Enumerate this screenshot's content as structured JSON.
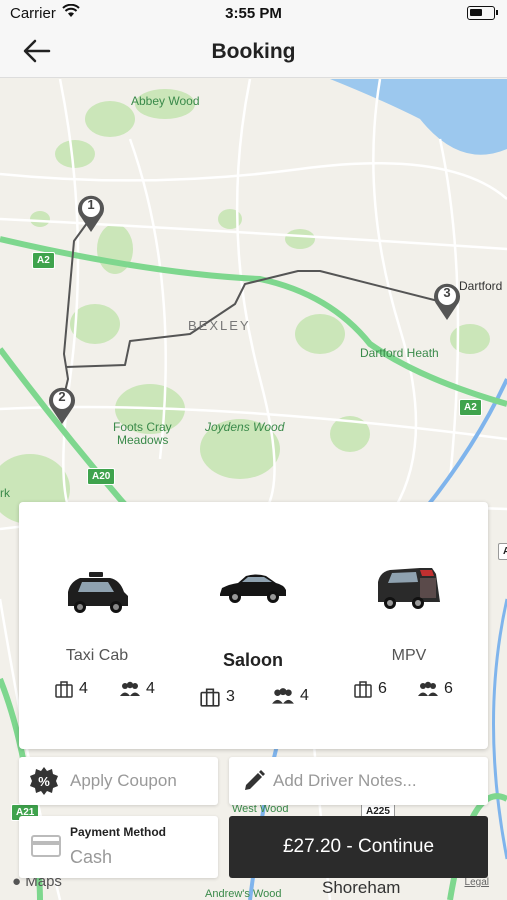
{
  "status_bar": {
    "carrier": "Carrier",
    "time": "3:55 PM"
  },
  "nav": {
    "title": "Booking"
  },
  "map": {
    "labels": {
      "abbey_wood": "Abbey Wood",
      "bexley": "BEXLEY",
      "dartford": "Dartford",
      "dartford_heath": "Dartford Heath",
      "foots_cray_1": "Foots Cray",
      "foots_cray_2": "Meadows",
      "joydens_wood": "Joydens Wood",
      "park": "rk",
      "shoreham": "Shoreham",
      "andrews_wood": "Andrew's Wood",
      "west_wood": "West Wood"
    },
    "roads": {
      "a2_left": "A2",
      "a2_right": "A2",
      "a20": "A20",
      "a21": "A21",
      "a225": "A225",
      "edge_a": "A"
    },
    "stops": [
      "1",
      "2",
      "3"
    ],
    "attribution": "Maps",
    "legal": "Legal"
  },
  "vehicles": [
    {
      "name": "Taxi Cab",
      "luggage": "4",
      "passengers": "4",
      "selected": false,
      "icon": "taxi-cab-icon"
    },
    {
      "name": "Saloon",
      "luggage": "3",
      "passengers": "4",
      "selected": true,
      "icon": "saloon-car-icon"
    },
    {
      "name": "MPV",
      "luggage": "6",
      "passengers": "6",
      "selected": false,
      "icon": "mpv-van-icon"
    }
  ],
  "actions": {
    "coupon_label": "Apply Coupon",
    "notes_label": "Add Driver Notes..."
  },
  "payment": {
    "title": "Payment Method",
    "value": "Cash"
  },
  "continue_label": "£27.20 - Continue",
  "colors": {
    "dark_button": "#2b2b2b",
    "road_green": "#7ed78e",
    "park_green": "#cbe6b9",
    "water_blue": "#9cc8ee"
  }
}
